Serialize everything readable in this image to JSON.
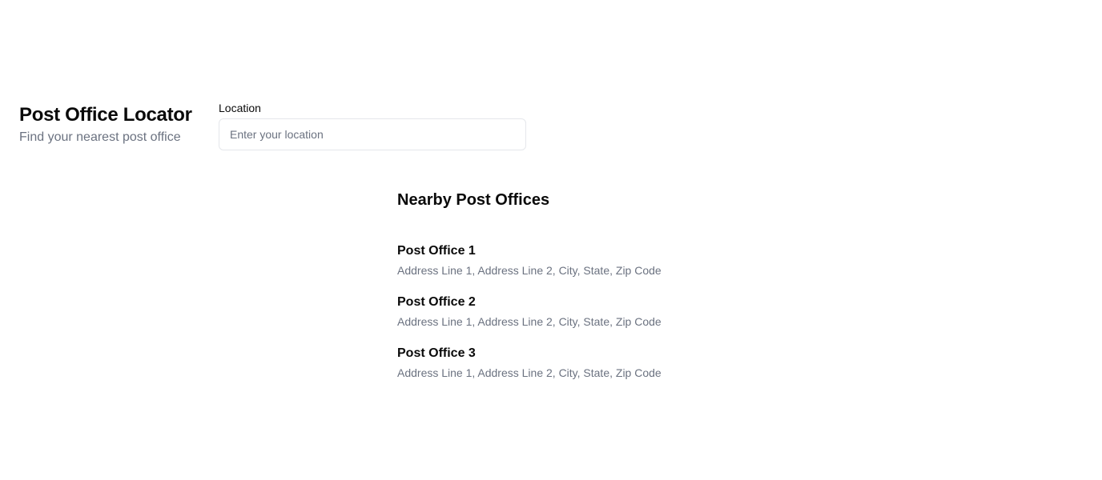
{
  "header": {
    "title": "Post Office Locator",
    "subtitle": "Find your nearest post office"
  },
  "search": {
    "label": "Location",
    "value": "",
    "placeholder": "Enter your location"
  },
  "results": {
    "title": "Nearby Post Offices",
    "items": [
      {
        "name": "Post Office 1",
        "address": "Address Line 1, Address Line 2, City, State, Zip Code"
      },
      {
        "name": "Post Office 2",
        "address": "Address Line 1, Address Line 2, City, State, Zip Code"
      },
      {
        "name": "Post Office 3",
        "address": "Address Line 1, Address Line 2, City, State, Zip Code"
      }
    ]
  },
  "colors": {
    "text_primary": "#0a0a0a",
    "text_muted": "#6b7280",
    "input_border": "#e5e7eb",
    "background": "#ffffff"
  }
}
